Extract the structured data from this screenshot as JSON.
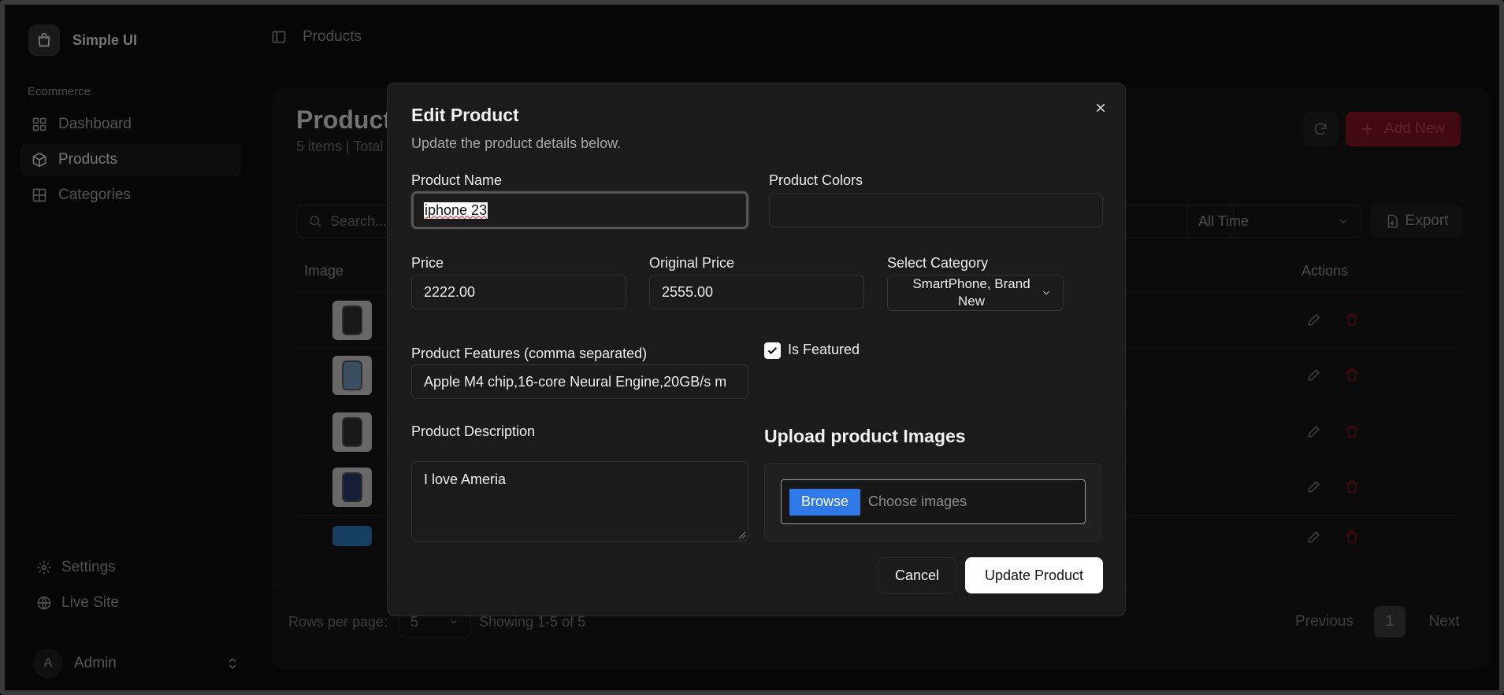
{
  "sidebar": {
    "brand": "Simple UI",
    "group_label": "Ecommerce",
    "items": [
      {
        "label": "Dashboard",
        "icon": "grid-icon"
      },
      {
        "label": "Products",
        "icon": "box-icon",
        "active": true
      },
      {
        "label": "Categories",
        "icon": "squares-icon"
      }
    ],
    "bottom": [
      {
        "label": "Settings",
        "icon": "gear-icon"
      },
      {
        "label": "Live Site",
        "icon": "globe-icon"
      }
    ],
    "user": {
      "initial": "A",
      "name": "Admin"
    }
  },
  "topbar": {
    "breadcrumb": "Products"
  },
  "page": {
    "title": "Products",
    "subtitle": "5 items | Total",
    "add_label": "Add New",
    "search_placeholder": "Search...",
    "time_filter": "All Time",
    "export_label": "Export",
    "columns": {
      "image": "Image",
      "actions": "Actions"
    },
    "rows_per_page_label": "Rows per page:",
    "rows_per_page_value": "5",
    "showing": "Showing 1-5 of 5",
    "prev_label": "Previous",
    "page_number": "1",
    "next_label": "Next"
  },
  "dialog": {
    "title": "Edit Product",
    "subtitle": "Update the product details below.",
    "fields": {
      "name_label": "Product Name",
      "name_value": "iphone 23",
      "colors_label": "Product Colors",
      "colors_value": "",
      "price_label": "Price",
      "price_value": "2222.00",
      "original_price_label": "Original Price",
      "original_price_value": "2555.00",
      "category_label": "Select Category",
      "category_value": "SmartPhone, Brand New",
      "features_label": "Product Features (comma separated)",
      "features_value": "Apple M4 chip,16-core Neural Engine,20GB/s m",
      "featured_label": "Is Featured",
      "featured_checked": true,
      "description_label": "Product Description",
      "description_value": "I love Ameria",
      "upload_title": "Upload product Images",
      "browse_label": "Browse",
      "upload_placeholder": "Choose images"
    },
    "cancel_label": "Cancel",
    "submit_label": "Update Product"
  },
  "colors": {
    "accent_blue": "#2f78e8",
    "add_button": "#7a1122",
    "background": "#0c0c0c",
    "dialog": "#1b1b1b"
  }
}
